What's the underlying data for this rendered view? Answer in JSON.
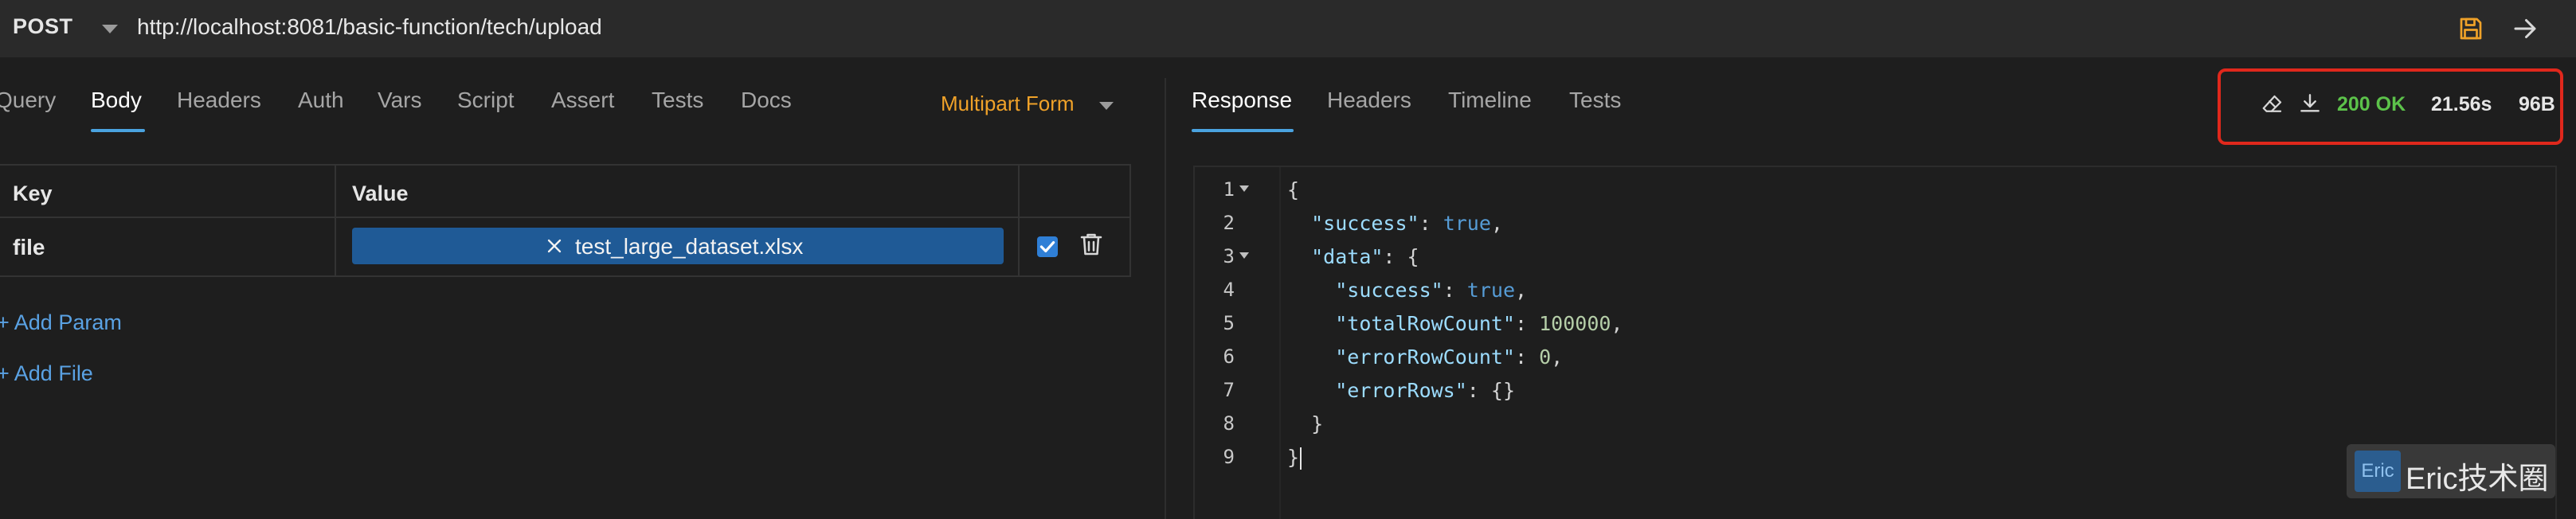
{
  "request": {
    "method": "POST",
    "url": "http://localhost:8081/basic-function/tech/upload"
  },
  "request_tabs": [
    {
      "label": "Query"
    },
    {
      "label": "Body"
    },
    {
      "label": "Headers"
    },
    {
      "label": "Auth"
    },
    {
      "label": "Vars"
    },
    {
      "label": "Script"
    },
    {
      "label": "Assert"
    },
    {
      "label": "Tests"
    },
    {
      "label": "Docs"
    }
  ],
  "active_request_tab": "Body",
  "body_mode": "Multipart Form",
  "params_table": {
    "headers": [
      "Key",
      "Value"
    ],
    "rows": [
      {
        "key": "file",
        "value": "test_large_dataset.xlsx",
        "enabled": true
      }
    ]
  },
  "add_param_label": "+ Add Param",
  "add_file_label": "+ Add File",
  "response_tabs": [
    {
      "label": "Response"
    },
    {
      "label": "Headers"
    },
    {
      "label": "Timeline"
    },
    {
      "label": "Tests"
    }
  ],
  "active_response_tab": "Response",
  "status": {
    "code_text": "200 OK",
    "time": "21.56s",
    "size": "96B"
  },
  "response_lines": [
    {
      "n": "1",
      "fold": true
    },
    {
      "n": "2",
      "fold": false
    },
    {
      "n": "3",
      "fold": true
    },
    {
      "n": "4",
      "fold": false
    },
    {
      "n": "5",
      "fold": false
    },
    {
      "n": "6",
      "fold": false
    },
    {
      "n": "7",
      "fold": false
    },
    {
      "n": "8",
      "fold": false
    },
    {
      "n": "9",
      "fold": false
    }
  ],
  "response_json": {
    "k_success": "\"success\"",
    "v_true": "true",
    "k_data": "\"data\"",
    "k_totalRowCount": "\"totalRowCount\"",
    "v_totalRowCount": "100000",
    "k_errorRowCount": "\"errorRowCount\"",
    "v_errorRowCount": "0",
    "k_errorRows": "\"errorRows\"",
    "v_errorRows": "{}"
  },
  "watermark": {
    "logo": "Eric",
    "text": "Eric技术圈"
  },
  "colors": {
    "accent": "#4aa3e0",
    "body_mode": "#f0a229",
    "status_ok": "#5cc24a",
    "highlight_box": "#e0281c",
    "file_chip": "#1f5a96"
  }
}
